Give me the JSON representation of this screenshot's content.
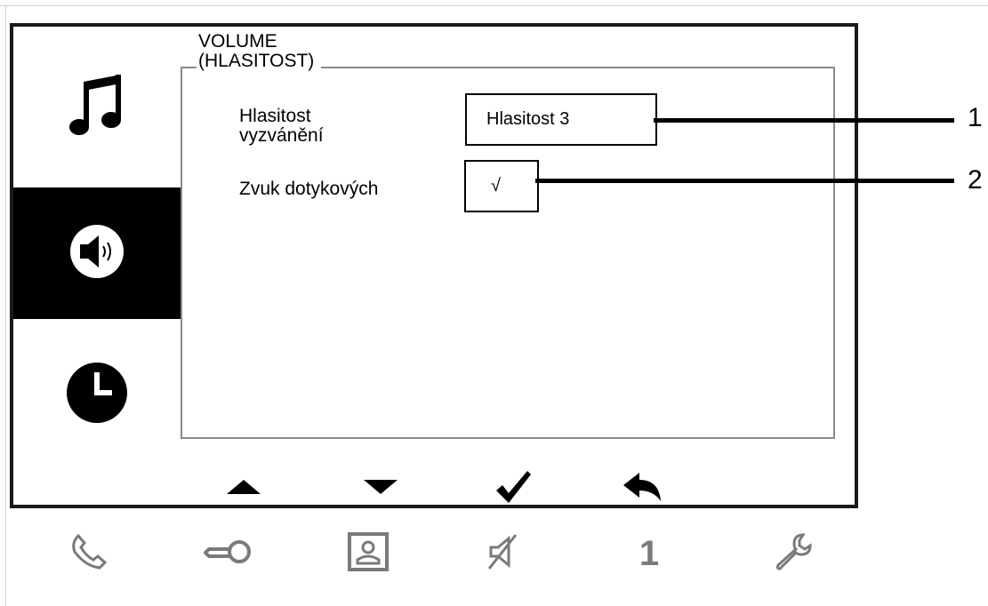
{
  "panel": {
    "legend_line1": "VOLUME",
    "legend_line2": "(HLASITOST)",
    "rows": [
      {
        "label_line1": "Hlasitost",
        "label_line2": "vyzvánění",
        "value": "Hlasitost 3"
      },
      {
        "label_line1": "Zvuk dotykových",
        "value": "√"
      }
    ]
  },
  "callouts": [
    "1",
    "2"
  ],
  "side_tabs": [
    {
      "icon": "music-note-icon",
      "active": false
    },
    {
      "icon": "speaker-icon",
      "active": true
    },
    {
      "icon": "clock-icon",
      "active": false
    }
  ],
  "nav_buttons": [
    "arrow-up-icon",
    "arrow-down-icon",
    "checkmark-icon",
    "back-arrow-icon"
  ],
  "bottom_bar": {
    "icons": [
      "phone-icon",
      "key-icon",
      "contact-card-icon",
      "mute-icon",
      "digit-indicator",
      "wrench-icon"
    ],
    "digit": "1"
  },
  "colors": {
    "frame": "#1a1a1a",
    "active_tab": "#000000",
    "panel_border": "#8a8a8a",
    "bottom_icons": "#7a7a7a"
  }
}
